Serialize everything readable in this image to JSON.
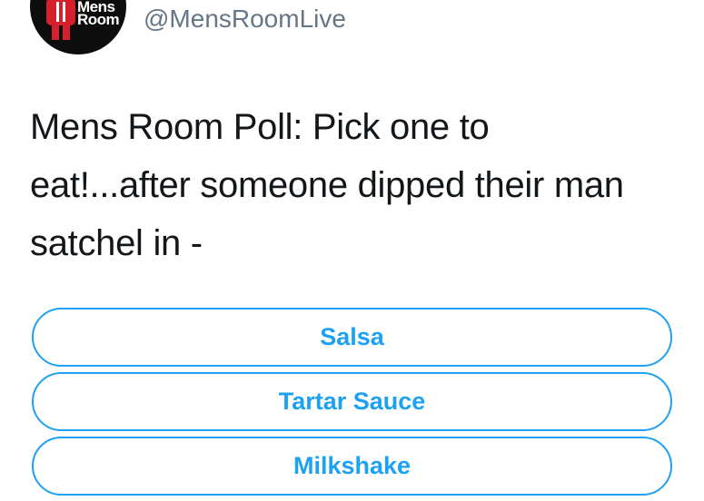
{
  "tweet": {
    "avatar": {
      "logo_line1": "Mens",
      "logo_line2": "Room"
    },
    "handle": "@MensRoomLive",
    "text_lines": [
      "Mens Room Poll: Pick one to",
      "eat!...after someone dipped their man",
      "satchel in -"
    ]
  },
  "poll": {
    "options": [
      {
        "label": "Salsa"
      },
      {
        "label": "Tartar Sauce"
      },
      {
        "label": "Milkshake"
      }
    ]
  },
  "colors": {
    "accent": "#1da1f2",
    "text": "#14171a",
    "handle": "#657786",
    "avatar_bg": "#0d0d0d",
    "logo_red": "#d6202b"
  }
}
